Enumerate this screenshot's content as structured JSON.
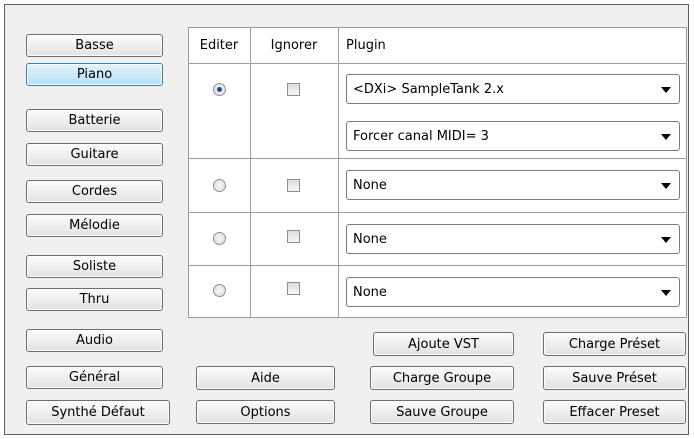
{
  "instruments": [
    "Basse",
    "Piano",
    "Batterie",
    "Guitare",
    "Cordes",
    "Mélodie",
    "Soliste",
    "Thru",
    "Audio",
    "Général",
    "Synthé Défaut"
  ],
  "active_instrument": "Piano",
  "table": {
    "headers": {
      "edit": "Editer",
      "ignore": "Ignorer",
      "plugin": "Plugin"
    },
    "rows": [
      {
        "selected": true,
        "ignored": false,
        "plugin": "<DXi> SampleTank 2.x",
        "midi": "Forcer canal MIDI= 3"
      },
      {
        "selected": false,
        "ignored": false,
        "plugin": "None"
      },
      {
        "selected": false,
        "ignored": false,
        "plugin": "None"
      },
      {
        "selected": false,
        "ignored": false,
        "plugin": "None"
      }
    ]
  },
  "buttons": {
    "aide": "Aide",
    "options": "Options",
    "ajoute_vst": "Ajoute VST",
    "charge_groupe": "Charge Groupe",
    "sauve_groupe": "Sauve Groupe",
    "charge_preset": "Charge Préset",
    "sauve_preset": "Sauve Préset",
    "effacer_preset": "Effacer Preset"
  }
}
